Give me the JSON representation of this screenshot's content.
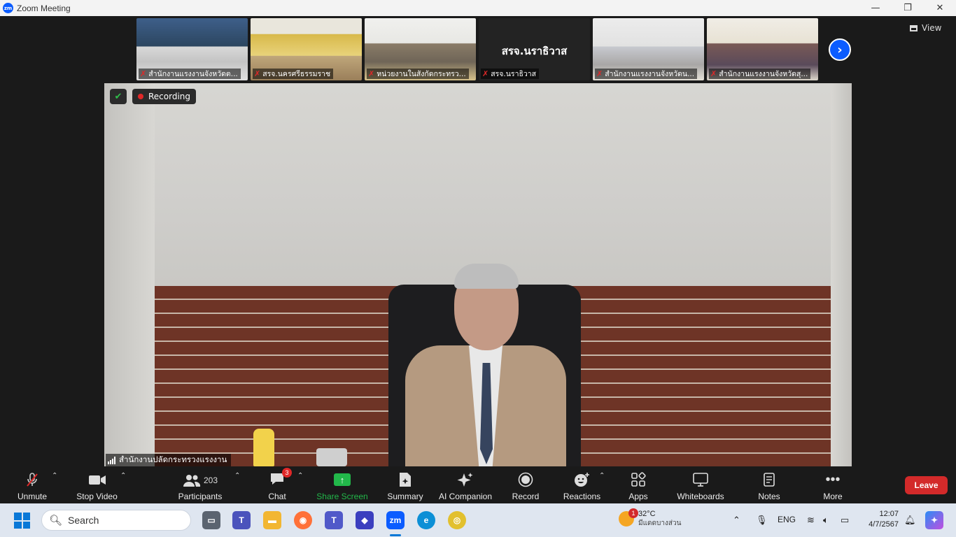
{
  "window": {
    "title": "Zoom Meeting",
    "minimize": "—",
    "maximize": "❐",
    "close": "✕"
  },
  "gallery": {
    "thumbnails": [
      {
        "name": "สำนักงานแรงงานจังหวัดต...",
        "muted": true
      },
      {
        "name": "สรจ.นครศรีธรรมราช",
        "muted": true
      },
      {
        "name": "หน่วยงานในสังกัดกระทรว...",
        "muted": true
      },
      {
        "name": "สรจ.นราธิวาส",
        "muted": true,
        "display_text": "สรจ.นราธิวาส"
      },
      {
        "name": "สำนักงานแรงงานจังหวัดน...",
        "muted": true
      },
      {
        "name": "สำนักงานแรงงานจังหวัดสุ...",
        "muted": true
      }
    ],
    "next_icon": "chevron-right-icon",
    "view_label": "View"
  },
  "main_video": {
    "recording_label": "Recording",
    "speaker_name": "สำนักงานปลัดกระทรวงแรงงาน"
  },
  "toolbar": {
    "unmute": "Unmute",
    "stop_video": "Stop Video",
    "participants": "Participants",
    "participants_count": "203",
    "chat": "Chat",
    "chat_badge": "3",
    "share_screen": "Share Screen",
    "summary": "Summary",
    "ai_companion": "AI Companion",
    "record": "Record",
    "reactions": "Reactions",
    "apps": "Apps",
    "whiteboards": "Whiteboards",
    "notes": "Notes",
    "more": "More",
    "leave": "Leave",
    "accent_green": "#22b84a",
    "leave_color": "#d32a2a"
  },
  "taskbar": {
    "search_placeholder": "Search",
    "weather_badge": "1",
    "weather_temp": "32°C",
    "weather_cond": "มีแดดบางส่วน",
    "language": "ENG",
    "time": "12:07",
    "date": "4/7/2567"
  }
}
